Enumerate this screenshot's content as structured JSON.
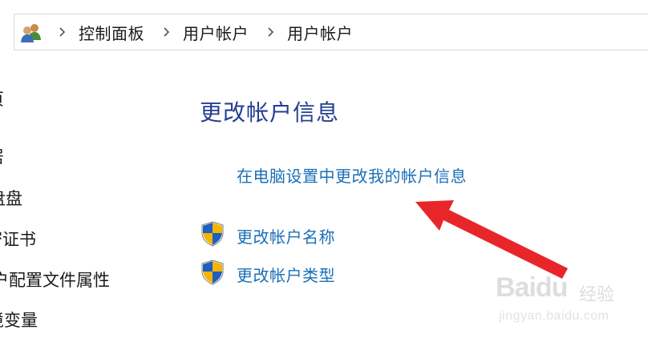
{
  "breadcrumb": {
    "items": [
      "控制面板",
      "用户帐户",
      "用户帐户"
    ]
  },
  "leftnav": {
    "items": [
      "页",
      "居",
      "盘盘",
      "密证书",
      "户配置文件属性",
      "境变量"
    ]
  },
  "main": {
    "heading": "更改帐户信息",
    "links": {
      "pc_settings": "在电脑设置中更改我的帐户信息",
      "change_name": "更改帐户名称",
      "change_type": "更改帐户类型"
    }
  },
  "watermark": {
    "brand": "Baidu",
    "cn": "经验",
    "url": "jingyan.baidu.com"
  },
  "colors": {
    "link": "#1a6fb8",
    "heading": "#233f8f",
    "annotation_arrow": "#e8262a"
  },
  "icons": {
    "address": "users-icon",
    "separator": "chevron-right-icon",
    "shield": "uac-shield-icon"
  }
}
